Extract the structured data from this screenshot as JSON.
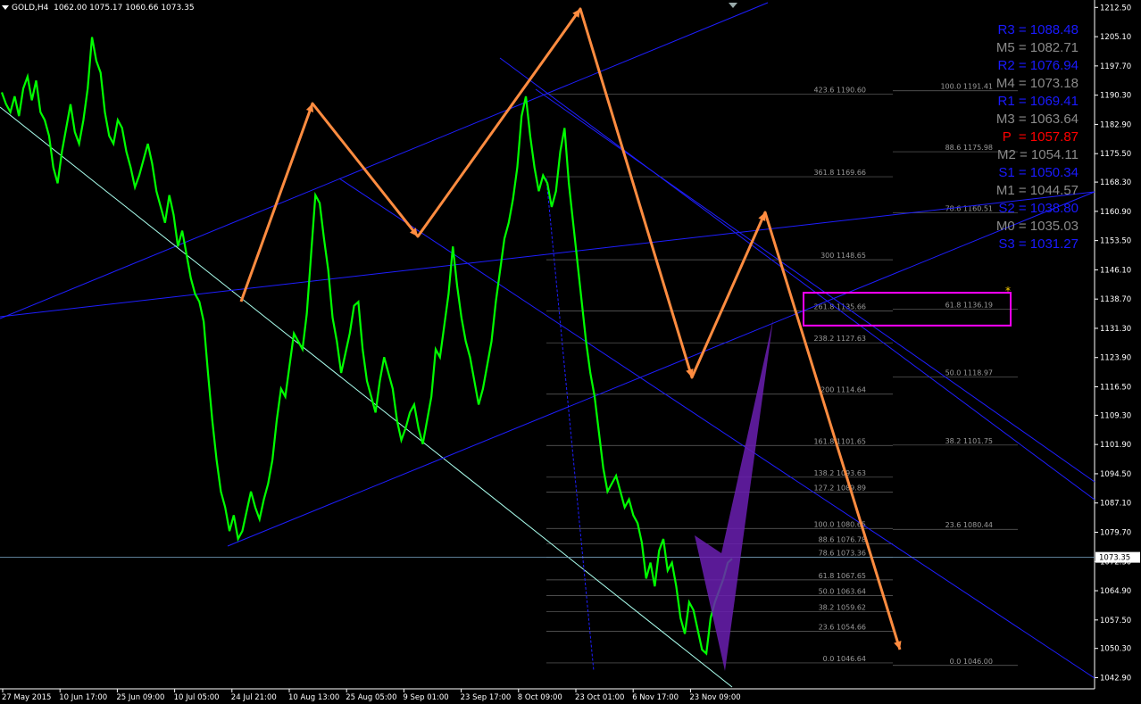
{
  "header": {
    "symbol": "GOLD,H4",
    "ohlc": "1062.00 1075.17 1060.66 1073.35"
  },
  "pivots": [
    {
      "label": "R3",
      "text": "R3 = 1088.48",
      "color": "#1a1aff"
    },
    {
      "label": "M5",
      "text": "M5 = 1082.71",
      "color": "#8a8a8a"
    },
    {
      "label": "R2",
      "text": "R2 = 1076.94",
      "color": "#1a1aff"
    },
    {
      "label": "M4",
      "text": "M4 = 1073.18",
      "color": "#8a8a8a"
    },
    {
      "label": "R1",
      "text": "R1 = 1069.41",
      "color": "#1a1aff"
    },
    {
      "label": "M3",
      "text": "M3 = 1063.64",
      "color": "#8a8a8a"
    },
    {
      "label": "P",
      "text": "P  = 1057.87",
      "color": "#ff0000"
    },
    {
      "label": "M2",
      "text": "M2 = 1054.11",
      "color": "#8a8a8a"
    },
    {
      "label": "S1",
      "text": "S1 = 1050.34",
      "color": "#1a1aff"
    },
    {
      "label": "M1",
      "text": "M1 = 1044.57",
      "color": "#8a8a8a"
    },
    {
      "label": "S2",
      "text": "S2 = 1038.80",
      "color": "#1a1aff"
    },
    {
      "label": "M0",
      "text": "M0 = 1035.03",
      "color": "#8a8a8a"
    },
    {
      "label": "S3",
      "text": "S3 = 1031.27",
      "color": "#1a1aff"
    }
  ],
  "chart_data": {
    "type": "line",
    "title": "",
    "ylim": [
      1040.3,
      1213.7
    ],
    "y_ticks": [
      "1212.50",
      "1205.10",
      "1197.70",
      "1190.30",
      "1182.90",
      "1175.50",
      "1168.30",
      "1160.90",
      "1153.50",
      "1146.10",
      "1138.70",
      "1131.30",
      "1123.90",
      "1116.50",
      "1109.30",
      "1101.90",
      "1094.50",
      "1087.10",
      "1079.70",
      "1072.30",
      "1064.90",
      "1057.50",
      "1050.30",
      "1042.90"
    ],
    "x_ticks": [
      "27 May 2015",
      "10 Jun 17:00",
      "25 Jun 09:00",
      "10 Jul 05:00",
      "24 Jul 21:00",
      "10 Aug 13:00",
      "25 Aug 05:00",
      "9 Sep 01:00",
      "23 Sep 17:00",
      "8 Oct 09:00",
      "23 Oct 01:00",
      "6 Nov 17:00",
      "23 Nov 09:00"
    ],
    "current_price": "1073.35",
    "series": [
      {
        "values": [
          1191,
          1188,
          1186,
          1190,
          1185,
          1192,
          1195,
          1189,
          1194,
          1186,
          1184,
          1180,
          1172,
          1168,
          1176,
          1182,
          1188,
          1181,
          1178,
          1184,
          1192,
          1205,
          1199,
          1196,
          1186,
          1180,
          1178,
          1184,
          1182,
          1176,
          1172,
          1167,
          1170,
          1174,
          1178,
          1173,
          1166,
          1162,
          1158,
          1165,
          1160,
          1152,
          1156,
          1150,
          1144,
          1140,
          1138,
          1133,
          1120,
          1108,
          1098,
          1090,
          1086,
          1080,
          1084,
          1078,
          1080,
          1085,
          1090,
          1086,
          1083,
          1088,
          1092,
          1098,
          1108,
          1116,
          1114,
          1122,
          1130,
          1128,
          1126,
          1135,
          1150,
          1165,
          1163,
          1154,
          1146,
          1134,
          1128,
          1120,
          1125,
          1130,
          1137,
          1138,
          1126,
          1118,
          1114,
          1110,
          1118,
          1124,
          1120,
          1116,
          1108,
          1103,
          1106,
          1110,
          1112,
          1106,
          1102,
          1108,
          1114,
          1126,
          1124,
          1132,
          1140,
          1152,
          1142,
          1134,
          1128,
          1124,
          1118,
          1112,
          1116,
          1122,
          1128,
          1138,
          1146,
          1154,
          1158,
          1164,
          1172,
          1185,
          1190,
          1180,
          1172,
          1166,
          1170,
          1168,
          1162,
          1166,
          1176,
          1182,
          1168,
          1158,
          1148,
          1138,
          1128,
          1120,
          1114,
          1105,
          1096,
          1090,
          1092,
          1094,
          1090,
          1086,
          1088,
          1084,
          1082,
          1077,
          1068,
          1072,
          1066,
          1075,
          1078,
          1070,
          1072,
          1066,
          1058,
          1054,
          1062,
          1060,
          1055,
          1050,
          1049,
          1058,
          1062,
          1065,
          1068,
          1072,
          1073
        ]
      }
    ],
    "fib_labels_left": [
      {
        "text": "423.6  1190.60",
        "price": 1190.6
      },
      {
        "text": "361.8  1169.66",
        "price": 1169.66
      },
      {
        "text": "300  1148.65",
        "price": 1148.65
      },
      {
        "text": "261.8  1135.66",
        "price": 1135.66
      },
      {
        "text": "238.2  1127.63",
        "price": 1127.63
      },
      {
        "text": "200  1114.64",
        "price": 1114.64
      },
      {
        "text": "161.8  1101.65",
        "price": 1101.65
      },
      {
        "text": "138.2  1093.63",
        "price": 1093.63
      },
      {
        "text": "127.2  1089.89",
        "price": 1089.89
      },
      {
        "text": "100.0  1080.65",
        "price": 1080.65
      },
      {
        "text": "88.6  1076.78",
        "price": 1076.78
      },
      {
        "text": "78.6  1073.36",
        "price": 1073.36
      },
      {
        "text": "61.8  1067.65",
        "price": 1067.65
      },
      {
        "text": "50.0  1063.64",
        "price": 1063.64
      },
      {
        "text": "38.2  1059.62",
        "price": 1059.62
      },
      {
        "text": "23.6  1054.66",
        "price": 1054.66
      },
      {
        "text": "0.0  1046.64",
        "price": 1046.64
      }
    ],
    "fib_labels_right": [
      {
        "text": "100.0  1191.41",
        "price": 1191.41
      },
      {
        "text": "88.6  1175.98",
        "price": 1175.98
      },
      {
        "text": "78.6  1160.51",
        "price": 1160.51
      },
      {
        "text": "61.8  1136.19",
        "price": 1136.19
      },
      {
        "text": "50.0  1118.97",
        "price": 1118.97
      },
      {
        "text": "38.2  1101.75",
        "price": 1101.75
      },
      {
        "text": "23.6  1080.44",
        "price": 1080.44
      },
      {
        "text": "0.0  1046.00",
        "price": 1046.0
      }
    ]
  },
  "colors": {
    "candles": "#00ff00",
    "channel": "#1e1eff",
    "trend": "#ffffff",
    "forecast": "#ff8c40",
    "zone": "#ff00ff",
    "pattern": "#6a1fb0",
    "fib": "#9a9a9a"
  }
}
